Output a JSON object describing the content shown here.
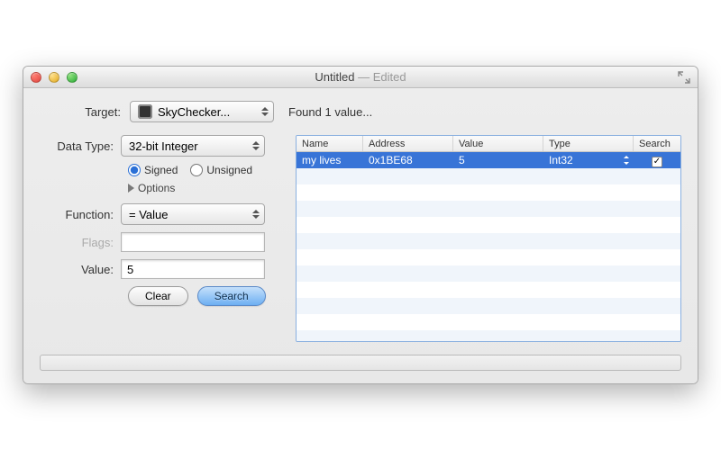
{
  "window": {
    "title": "Untitled",
    "edited_label": "— Edited"
  },
  "top": {
    "target_label": "Target:",
    "target_value": "SkyChecker...",
    "found_text": "Found 1 value..."
  },
  "left": {
    "data_type_label": "Data Type:",
    "data_type_value": "32-bit Integer",
    "signed_label": "Signed",
    "unsigned_label": "Unsigned",
    "signed_selected": "signed",
    "options_label": "Options",
    "function_label": "Function:",
    "function_value": "= Value",
    "flags_label": "Flags:",
    "flags_value": "",
    "value_label": "Value:",
    "value_value": "5",
    "clear_label": "Clear",
    "search_label": "Search"
  },
  "table": {
    "columns": {
      "name": "Name",
      "address": "Address",
      "value": "Value",
      "type": "Type",
      "search": "Search"
    },
    "rows": [
      {
        "name": "my lives",
        "address": "0x1BE68",
        "value": "5",
        "type": "Int32",
        "search_checked": true,
        "selected": true
      }
    ],
    "blank_row_count": 11
  }
}
